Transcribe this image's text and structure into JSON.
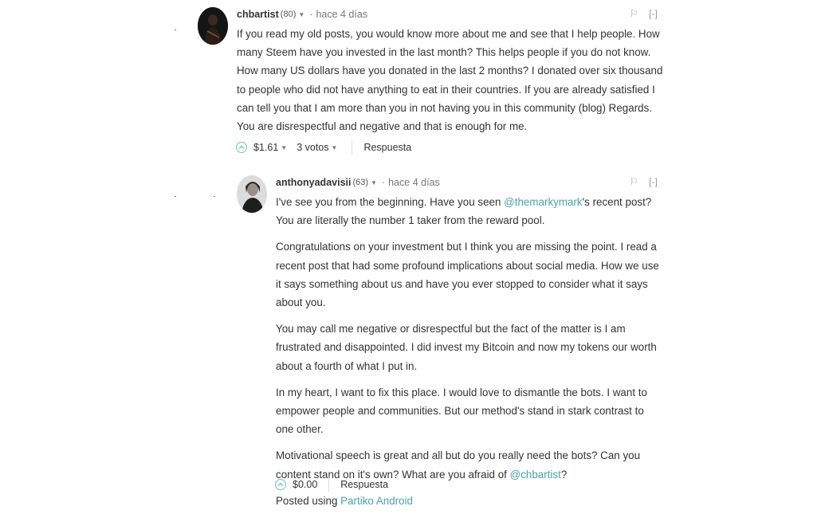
{
  "comments": [
    {
      "author": "chbartist",
      "reputation": "(80)",
      "time": "hace 4 días",
      "paragraphs": [
        "If you read my old posts, you would know more about me and see that I help people. How many Steem have you invested in the last month? This helps people if you do not know. How many US dollars have you donated in the last 2 months? I donated over six thousand to people who did not have anything to eat in their countries. If you are already satisfied I can tell you that I am more than you in not having you in this community (blog) Regards. You are disrespectful and negative and that is enough for me."
      ],
      "payout": "$1.61",
      "votes": "3 votos",
      "reply_label": "Respuesta",
      "flag_label": "⚐",
      "collapse_label": "[-]"
    },
    {
      "author": "anthonyadavisii",
      "reputation": "(63)",
      "time": "hace 4 días",
      "p1_pre": "I've see you from the beginning. Have you seen ",
      "p1_mention": "@themarkymark",
      "p1_post": "'s recent post? You are literally the number 1 taker from the reward pool.",
      "p2": "Congratulations on your investment but I think you are missing the point. I read a recent post that had some profound implications about social media. How we use it says something about us and have you ever stopped to consider what it says about you.",
      "p3": "You may call me negative or disrespectful but the fact of the matter is I am frustrated and disappointed. I did invest my Bitcoin and now my tokens our worth about a fourth of what I put in.",
      "p4": "In my heart, I want to fix this place. I would love to dismantle the bots. I want to empower people and communities. But our method's stand in stark contrast to one other.",
      "p5_pre": "Motivational speech is great and all but do you really need the bots? Can you content stand on it's own? What are you afraid of ",
      "p5_mention": "@chbartist",
      "p5_post": "?",
      "posted_using": "Posted using ",
      "posted_app": "Partiko Android",
      "payout": "$0.00",
      "reply_label": "Respuesta",
      "flag_label": "⚐",
      "collapse_label": "[-]"
    }
  ],
  "colors": {
    "accent": "#4ba2a8",
    "vote_circle": "#6fc3b4"
  },
  "icons": {
    "upvote": "chevron-up-icon",
    "dropdown": "caret-down-icon",
    "flag": "flag-icon"
  }
}
